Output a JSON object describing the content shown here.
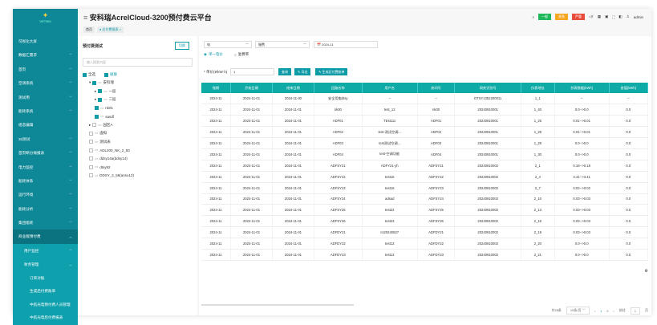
{
  "app": {
    "title": "安科瑞AcrelCloud-3200预付费云平台",
    "logo": "VIETWIN",
    "logo_sub": "伟通千里"
  },
  "breadcrumb": [
    "首页",
    "后付费报表"
  ],
  "header_tools": {
    "tags": [
      {
        "label": "一般",
        "color": "#1fb95b"
      },
      {
        "label": "紧急",
        "color": "#f5a623"
      },
      {
        "label": "严重",
        "color": "#e74c3c"
      }
    ],
    "user": "admin"
  },
  "sidebar": [
    {
      "label": "可视化大屏"
    },
    {
      "label": "数据汇需求",
      "chev": "﹀"
    },
    {
      "label": "首页",
      "chev": "﹀"
    },
    {
      "label": "空调系统",
      "chev": "﹀"
    },
    {
      "label": "测试用",
      "chev": "﹀"
    },
    {
      "label": "能耗系统",
      "chev": "﹀"
    },
    {
      "label": "组态编辑"
    },
    {
      "label": "3d测试",
      "chev": "﹀"
    },
    {
      "label": "首页断分摊报表",
      "chev": "﹀"
    },
    {
      "label": "电力监控",
      "chev": "﹀"
    },
    {
      "label": "能耗体系",
      "chev": "﹀"
    },
    {
      "label": "运行环境",
      "chev": "﹀"
    },
    {
      "label": "能耗分析",
      "chev": "﹀"
    },
    {
      "label": "集团能耗",
      "chev": "﹀"
    },
    {
      "label": "商业版预付费",
      "chev": "︿",
      "cls": "open"
    },
    {
      "label": "用户监控",
      "chev": "﹀",
      "cls": "sub"
    },
    {
      "label": "财务管理",
      "chev": "︿",
      "cls": "sub"
    },
    {
      "label": "订单对账",
      "cls": "sub2"
    },
    {
      "label": "生成后付费账单",
      "cls": "sub2"
    },
    {
      "label": "中航光电预付费人员管理",
      "cls": "sub2"
    },
    {
      "label": "中航光电后付费报表",
      "cls": "sub2"
    }
  ],
  "tree": {
    "title": "预付费测试",
    "switch": "切换",
    "search_placeholder": "输入搜索内容",
    "select_all": "全选",
    "cascade": "级联",
    "nodes": [
      {
        "label": "安科瑞",
        "lvl": 0,
        "on": true,
        "arrow": "▾"
      },
      {
        "label": "一层",
        "lvl": 1,
        "on": true,
        "arrow": "▸"
      },
      {
        "label": "二层",
        "lvl": 1,
        "on": true,
        "arrow": "▸"
      },
      {
        "label": "nk01",
        "lvl": 1,
        "on": true
      },
      {
        "label": "sasdf",
        "lvl": 1,
        "on": true
      },
      {
        "label": "园区A",
        "lvl": 0,
        "arrow": "▸"
      },
      {
        "label": "虚拟",
        "lvl": 0
      },
      {
        "label": "测试表",
        "lvl": 0
      },
      {
        "label": "ADL200_NK_2_50",
        "lvl": 0
      },
      {
        "label": "ddsy14a(ddsy14)",
        "lvl": 0
      },
      {
        "label": "dtsy92",
        "lvl": 0
      },
      {
        "label": "DDSY_2_56(ansu12)",
        "lvl": 0
      }
    ]
  },
  "filters": {
    "energy": "电",
    "type": "服费",
    "month": "2024-11",
    "radio1": "单一电价",
    "radio2": "复费率",
    "price_label": "* 单价(¥/kW·h)",
    "price": "1",
    "query": "查询",
    "export": "导出",
    "generate": "生成后付费账单"
  },
  "table": {
    "columns": [
      "账期",
      "开始日期",
      "结束日期",
      "回路名称",
      "用户名",
      "房间号",
      "网关识别号",
      "仪表地址",
      "抄表数据(kWh)",
      "差值(kWh)"
    ],
    "rows": [
      [
        "2024-11",
        "2024-11-01",
        "2024-11-30",
        "安全用电dtsy",
        "--",
        "--",
        "DTSY1352200011",
        "1_1",
        "--",
        "--"
      ],
      [
        "2024-11",
        "2024-11-01",
        "2024-11-01",
        "nk00",
        "test_12",
        "nk00",
        "20240910001",
        "1_40",
        "0.0-->0.0",
        "0.0"
      ],
      [
        "2024-11",
        "2024-11-01",
        "2024-11-01",
        "ADF01",
        "TEst111",
        "ADF01",
        "20240910001",
        "1_25",
        "0.01-->0.01",
        "0.0"
      ],
      [
        "2024-11",
        "2024-11-01",
        "2024-11-01",
        "ADF02",
        "test-测试空调...",
        "ADF02",
        "20240910001",
        "1_28",
        "0.01-->0.01",
        "0.0"
      ],
      [
        "2024-11",
        "2024-11-01",
        "2024-11-01",
        "ADF03",
        "test测试空调...",
        "ADF03",
        "20240910001",
        "1_29",
        "0.0-->0.0",
        "0.0"
      ],
      [
        "2024-11",
        "2024-11-01",
        "2024-11-01",
        "ADF04",
        "test-空调功能",
        "ADF04",
        "20240910001",
        "1_30",
        "0.0-->0.0",
        "0.0"
      ],
      [
        "2024-11",
        "2024-11-01",
        "2024-11-01",
        "ADFSY21",
        "ADFY21-yh",
        "ADFSY21",
        "20240910002",
        "2_1",
        "0.18-->0.18",
        "0.0"
      ],
      [
        "2024-11",
        "2024-11-01",
        "2024-11-01",
        "ADFSY22",
        "test15",
        "ADFSY22",
        "20240910002",
        "2_4",
        "3.41-->3.41",
        "0.0"
      ],
      [
        "2024-11",
        "2024-11-01",
        "2024-11-01",
        "ADFSY23",
        "test16",
        "ADFSY23",
        "20240910002",
        "2_7",
        "0.02-->0.02",
        "0.0"
      ],
      [
        "2024-11",
        "2024-11-01",
        "2024-11-01",
        "ADFSY24",
        "adsad",
        "ADFSY24",
        "20240910002",
        "2_10",
        "0.03-->0.03",
        "0.0"
      ],
      [
        "2024-11",
        "2024-11-01",
        "2024-11-01",
        "ADFSY25",
        "test22",
        "ADFSY25",
        "20240910002",
        "2_13",
        "0.03-->0.03",
        "0.0"
      ],
      [
        "2024-11",
        "2024-11-01",
        "2024-11-01",
        "ADFSY26",
        "test23",
        "ADFSY26",
        "20240910002",
        "2_16",
        "0.03-->0.03",
        "0.0"
      ],
      [
        "2024-11",
        "2024-11-01",
        "2024-11-01",
        "ADFDY21",
        "cs20240827",
        "ADFDY21",
        "20240910002",
        "2_19",
        "0.03-->0.03",
        "0.0"
      ],
      [
        "2024-11",
        "2024-11-01",
        "2024-11-01",
        "ADFDY22",
        "test13",
        "ADFDY22",
        "20240910002",
        "2_20",
        "0.0-->0.0",
        "0.0"
      ],
      [
        "2024-11",
        "2024-11-01",
        "2024-11-01",
        "ADFDY23",
        "test13",
        "ADFDY23",
        "20240910002",
        "2_21",
        "0.0-->0.0",
        "0.0"
      ]
    ]
  },
  "pagination": {
    "total": "共28条",
    "page_size": "15条/页",
    "pages": [
      "1",
      "2"
    ],
    "current": "1",
    "goto_label": "前往",
    "goto_value": "1",
    "page_unit": "页"
  }
}
